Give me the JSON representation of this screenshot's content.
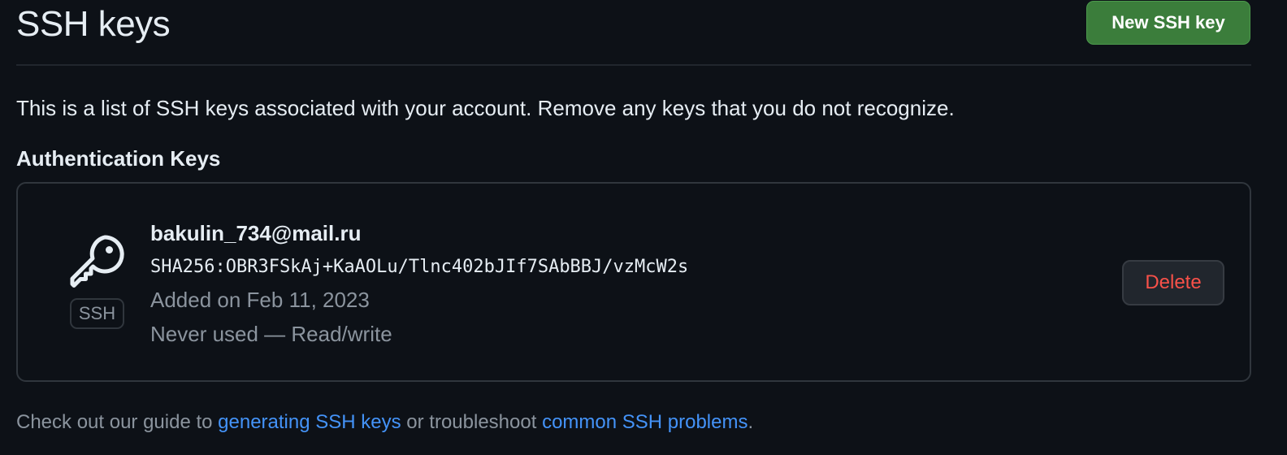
{
  "header": {
    "title": "SSH keys",
    "new_key_label": "New SSH key"
  },
  "intro": "This is a list of SSH keys associated with your account. Remove any keys that you do not recognize.",
  "section": {
    "heading": "Authentication Keys"
  },
  "keys": [
    {
      "icon": "key-icon",
      "badge": "SSH",
      "title": "bakulin_734@mail.ru",
      "fingerprint": "SHA256:OBR3FSkAj+KaAOLu/Tlnc402bJIf7SAbBBJ/vzMcW2s",
      "added": "Added on Feb 11, 2023",
      "usage": "Never used — Read/write",
      "delete_label": "Delete"
    }
  ],
  "footer": {
    "prefix": "Check out our guide to ",
    "link1": "generating SSH keys",
    "middle": " or troubleshoot ",
    "link2": "common SSH problems",
    "suffix": "."
  },
  "colors": {
    "background": "#0d1117",
    "primary_button": "#3b7d3b",
    "danger": "#f85149",
    "link": "#4493f8",
    "muted_text": "#8b949e"
  }
}
